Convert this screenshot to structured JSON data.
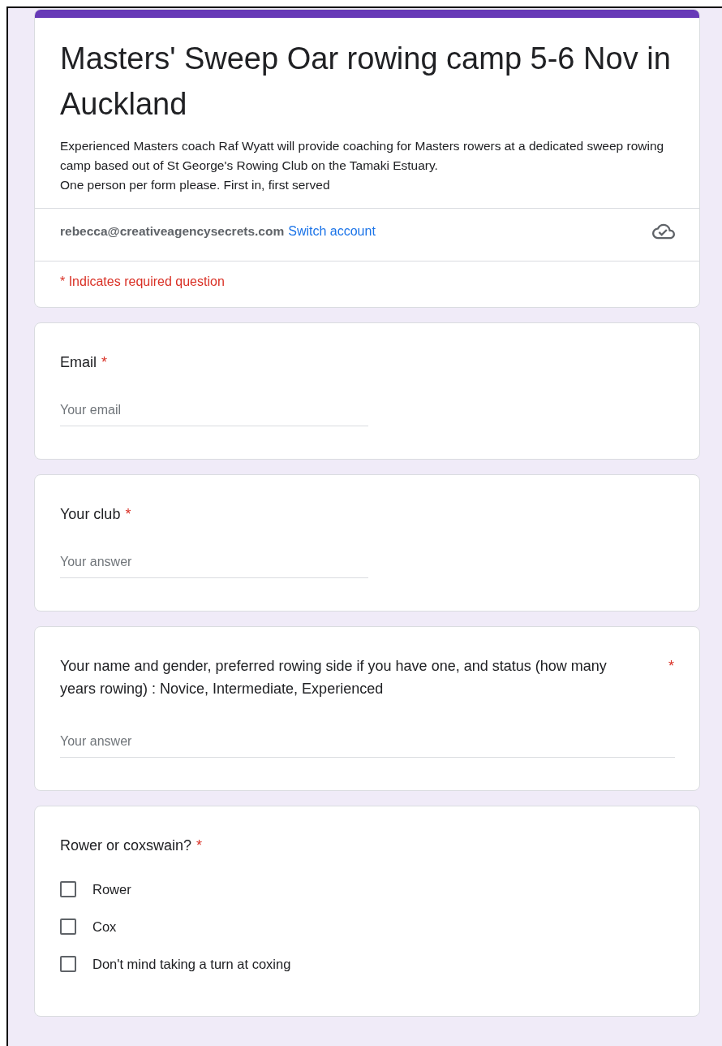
{
  "header": {
    "title": "Masters' Sweep Oar rowing camp 5-6 Nov in Auckland",
    "description": [
      "Experienced Masters coach Raf Wyatt will provide coaching for Masters rowers at a dedicated sweep rowing camp based out of St George's Rowing Club on the Tamaki Estuary.",
      "One person per form please. First in, first served"
    ],
    "account": "rebecca@creativeagencysecrets.com",
    "switch_link": "Switch account",
    "required_note": "* Indicates required question"
  },
  "questions": [
    {
      "kind": "short",
      "label": "Email",
      "required_mark": "*",
      "placeholder": "Your email"
    },
    {
      "kind": "short",
      "label": "Your club",
      "required_mark": "*",
      "placeholder": "Your answer"
    },
    {
      "kind": "long",
      "label": "Your name and gender, preferred rowing side if you have one, and status  (how many years rowing) : Novice, Intermediate, Experienced",
      "required_mark": "*",
      "placeholder": "Your answer"
    },
    {
      "kind": "checkboxes",
      "label": "Rower or coxswain?",
      "required_mark": "*",
      "options": [
        {
          "label": "Rower",
          "checked": false
        },
        {
          "label": "Cox",
          "checked": false
        },
        {
          "label": "Don't mind taking a turn at coxing",
          "checked": false
        }
      ]
    }
  ]
}
